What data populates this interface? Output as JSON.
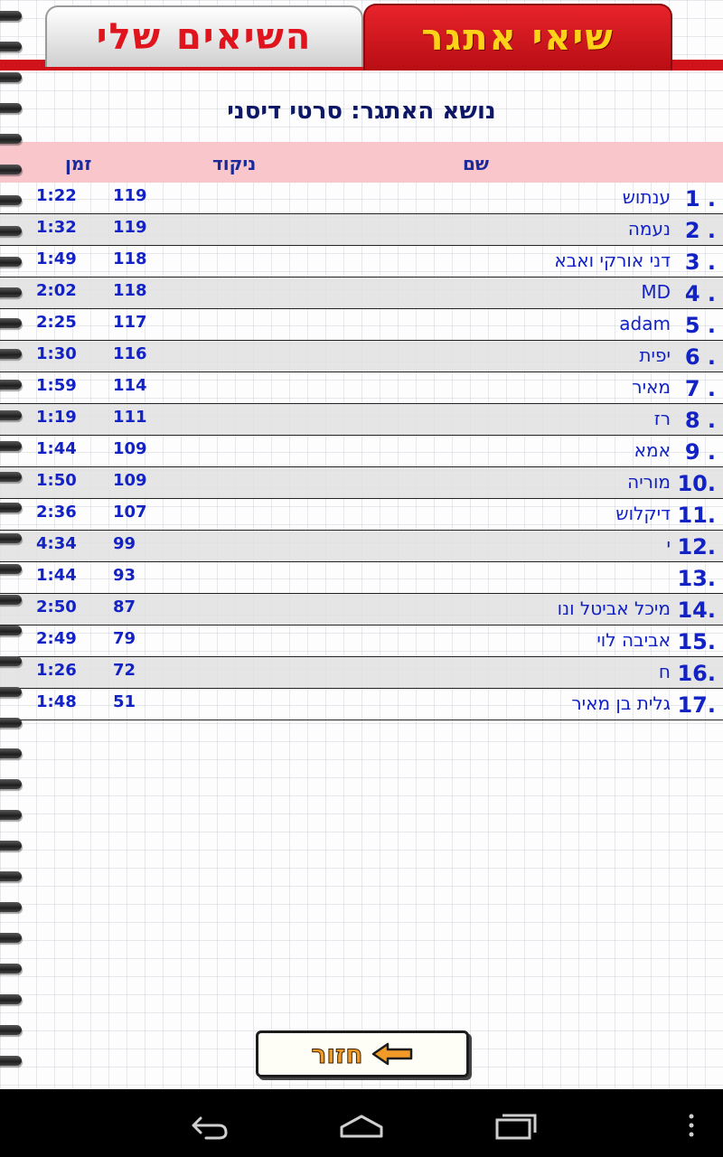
{
  "tabs": {
    "records": "שיאי אתגר",
    "mine": "השיאים שלי"
  },
  "title": "נושא האתגר: סרטי דיסני",
  "columns": {
    "name": "שם",
    "score": "ניקוד",
    "time": "זמן"
  },
  "rows": [
    {
      "rank": "1 .",
      "name": "ענתוש",
      "score": "119",
      "time": "1:22"
    },
    {
      "rank": "2 .",
      "name": "נעמה",
      "score": "119",
      "time": "1:32"
    },
    {
      "rank": "3 .",
      "name": "דני אורקי ואבא",
      "score": "118",
      "time": "1:49"
    },
    {
      "rank": "4 .",
      "name": "MD",
      "score": "118",
      "time": "2:02"
    },
    {
      "rank": "5 .",
      "name": "adam",
      "score": "117",
      "time": "2:25"
    },
    {
      "rank": "6 .",
      "name": "יפית",
      "score": "116",
      "time": "1:30"
    },
    {
      "rank": "7 .",
      "name": "מאיר",
      "score": "114",
      "time": "1:59"
    },
    {
      "rank": "8 .",
      "name": "רז",
      "score": "111",
      "time": "1:19"
    },
    {
      "rank": "9 .",
      "name": "אמא",
      "score": "109",
      "time": "1:44"
    },
    {
      "rank": "10.",
      "name": "מוריה",
      "score": "109",
      "time": "1:50"
    },
    {
      "rank": "11.",
      "name": "דיקלוש",
      "score": "107",
      "time": "2:36"
    },
    {
      "rank": "12.",
      "name": "י",
      "score": "99",
      "time": "4:34"
    },
    {
      "rank": "13.",
      "name": "",
      "score": "93",
      "time": "1:44"
    },
    {
      "rank": "14.",
      "name": "מיכל אביטל ונו",
      "score": "87",
      "time": "2:50"
    },
    {
      "rank": "15.",
      "name": "אביבה לוי",
      "score": "79",
      "time": "2:49"
    },
    {
      "rank": "16.",
      "name": "ח",
      "score": "72",
      "time": "1:26"
    },
    {
      "rank": "17.",
      "name": "גלית בן מאיר",
      "score": "51",
      "time": "1:48"
    }
  ],
  "back_button": {
    "label": "חזור",
    "icon": "arrow-left-icon"
  },
  "navbar": {
    "back_icon": "back-icon",
    "home_icon": "home-icon",
    "recents_icon": "recents-icon",
    "menu_icon": "menu-icon"
  },
  "colors": {
    "tab_red": "#d0121b",
    "tab_yellow": "#ffd21a",
    "header_pink": "#f8c6cb",
    "text_blue": "#1222c4",
    "title_navy": "#0d1766"
  }
}
